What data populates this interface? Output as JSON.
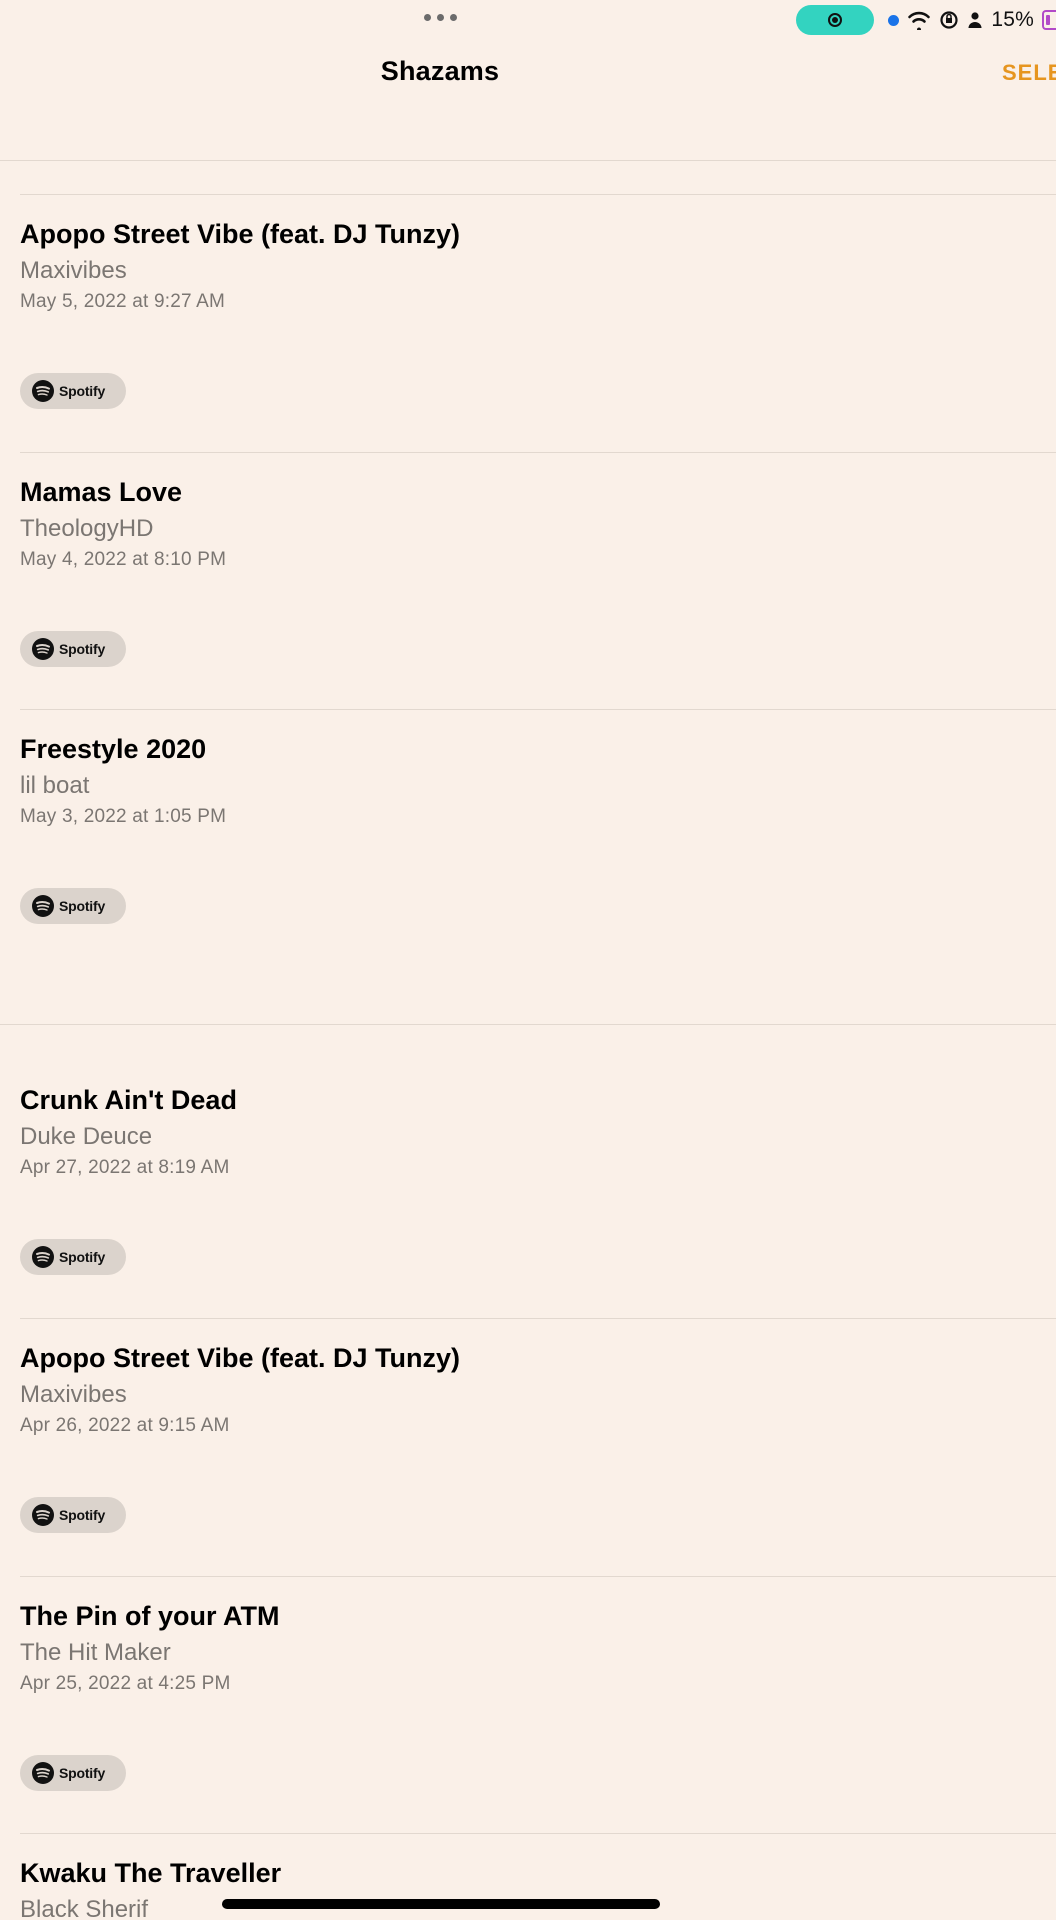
{
  "status_bar": {
    "battery_percent": "15%",
    "icons": [
      "more-dots-icon",
      "screen-record-icon",
      "location-dot-icon",
      "wifi-icon",
      "orientation-lock-icon",
      "person-icon",
      "battery-icon"
    ],
    "record_color": "#33D3C0",
    "battery_color": "#b24ac8"
  },
  "nav": {
    "title": "Shazams",
    "select_label": "SELECT",
    "accent_color": "#E6951F"
  },
  "spotify_label": "Spotify",
  "items": [
    {
      "title": "Apopo Street Vibe (feat. DJ Tunzy)",
      "artist": "Maxivibes",
      "date": "May 5, 2022 at 9:27 AM"
    },
    {
      "title": "Mamas Love",
      "artist": "TheologyHD",
      "date": "May 4, 2022 at 8:10 PM"
    },
    {
      "title": "Freestyle 2020",
      "artist": "lil boat",
      "date": "May 3, 2022 at 1:05 PM"
    },
    {
      "title": "Crunk Ain't Dead",
      "artist": "Duke Deuce",
      "date": "Apr 27, 2022 at 8:19 AM"
    },
    {
      "title": "Apopo Street Vibe (feat. DJ Tunzy)",
      "artist": "Maxivibes",
      "date": "Apr 26, 2022 at 9:15 AM"
    },
    {
      "title": "The Pin of your ATM",
      "artist": "The Hit Maker",
      "date": "Apr 25, 2022 at 4:25 PM"
    },
    {
      "title": "Kwaku The Traveller",
      "artist": "Black Sherif",
      "date": ""
    }
  ]
}
